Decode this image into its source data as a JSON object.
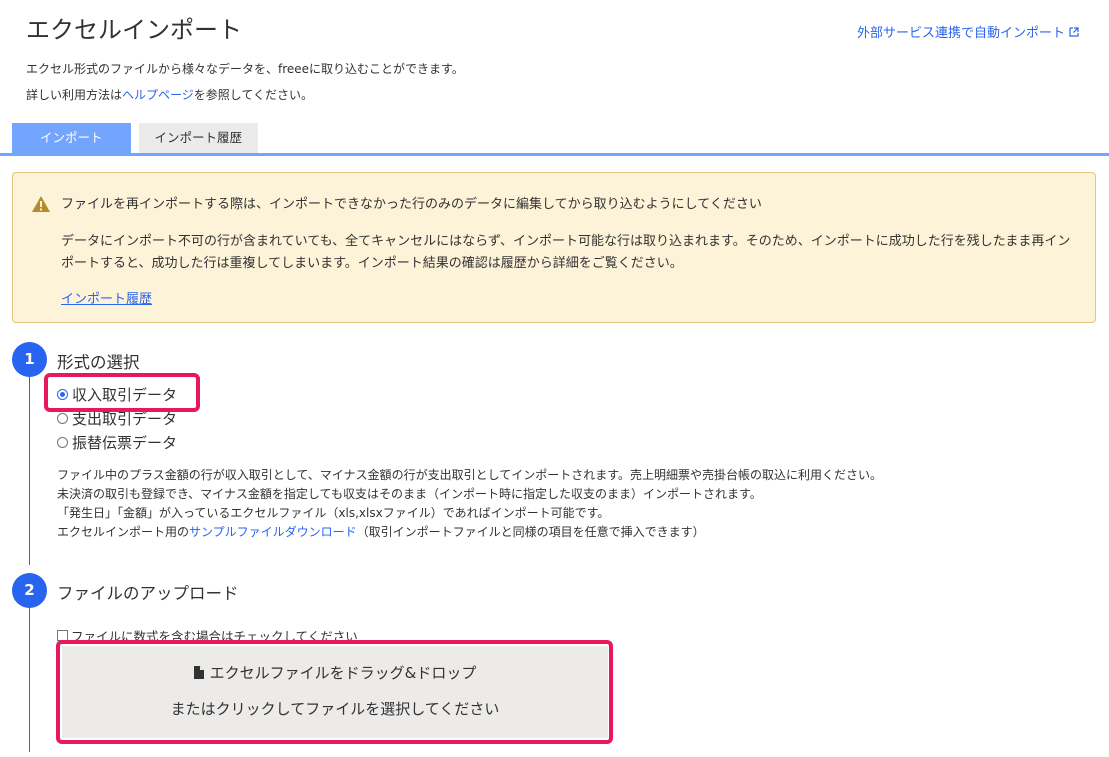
{
  "header": {
    "title": "エクセルインポート",
    "external_link": "外部サービス連携で自動インポート",
    "description_line1": "エクセル形式のファイルから様々なデータを、freeeに取り込むことができます。",
    "description_line2_prefix": "詳しい利用方法は",
    "description_line2_link": "ヘルプページ",
    "description_line2_suffix": "を参照してください。"
  },
  "tabs": [
    {
      "label": "インポート",
      "active": true
    },
    {
      "label": "インポート履歴",
      "active": false
    }
  ],
  "warning": {
    "title": "ファイルを再インポートする際は、インポートできなかった行のみのデータに編集してから取り込むようにしてください",
    "body": "データにインポート不可の行が含まれていても、全てキャンセルにはならず、インポート可能な行は取り込まれます。そのため、インポートに成功した行を残したまま再インポートすると、成功した行は重複してしまいます。インポート結果の確認は履歴から詳細をご覧ください。",
    "link": "インポート履歴"
  },
  "step1": {
    "number": "1",
    "title": "形式の選択",
    "options": [
      {
        "label": "収入取引データ",
        "selected": true
      },
      {
        "label": "支出取引データ",
        "selected": false
      },
      {
        "label": "振替伝票データ",
        "selected": false
      }
    ],
    "desc_line1": "ファイル中のプラス金額の行が収入取引として、マイナス金額の行が支出取引としてインポートされます。売上明細票や売掛台帳の取込に利用ください。",
    "desc_line2": "未決済の取引も登録でき、マイナス金額を指定しても収支はそのまま（インポート時に指定した収支のまま）インポートされます。",
    "desc_line3": "「発生日」「金額」が入っているエクセルファイル（xls,xlsxファイル）であればインポート可能です。",
    "desc_line4_prefix": "エクセルインポート用の",
    "desc_line4_link": "サンプルファイルダウンロード",
    "desc_line4_suffix": "（取引インポートファイルと同様の項目を任意で挿入できます）"
  },
  "step2": {
    "number": "2",
    "title": "ファイルのアップロード",
    "checkbox_label": "ファイルに数式を含む場合はチェックしてください",
    "dropzone_line1": "エクセルファイルをドラッグ&ドロップ",
    "dropzone_line2": "またはクリックしてファイルを選択してください"
  },
  "colors": {
    "accent": "#2864f0",
    "tab_active": "#73a5ff",
    "highlight": "#e6195a",
    "warning_bg": "#fdf3d9",
    "warning_border": "#e8c37a"
  }
}
